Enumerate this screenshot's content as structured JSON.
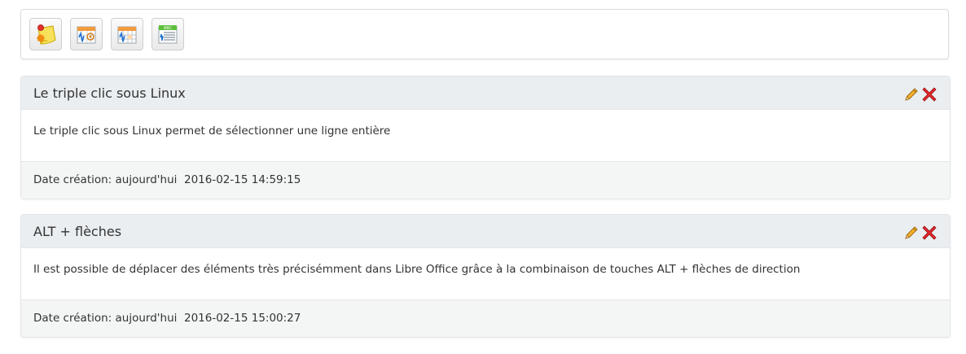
{
  "toolbar": {
    "buttons": [
      {
        "icon": "new-note-icon"
      },
      {
        "icon": "calendar-settings-icon"
      },
      {
        "icon": "calendar-grid-icon"
      },
      {
        "icon": "list-view-icon"
      }
    ]
  },
  "notes": [
    {
      "title": "Le triple clic sous Linux",
      "body": "Le triple clic sous Linux permet de sélectionner une ligne entière",
      "created_label": "Date création:",
      "created_relative": "aujourd'hui",
      "created_datetime": "2016-02-15 14:59:15"
    },
    {
      "title": "ALT + flèches",
      "body": "Il est possible de déplacer des éléments très précisémment dans Libre Office grâce à la combinaison de touches ALT + flèches de direction",
      "created_label": "Date création:",
      "created_relative": "aujourd'hui",
      "created_datetime": "2016-02-15 15:00:27"
    }
  ],
  "colors": {
    "header_bg": "#eaeef1",
    "footer_bg": "#f4f5f5",
    "delete_red": "#e0282c",
    "pencil_orange": "#f0a020"
  }
}
